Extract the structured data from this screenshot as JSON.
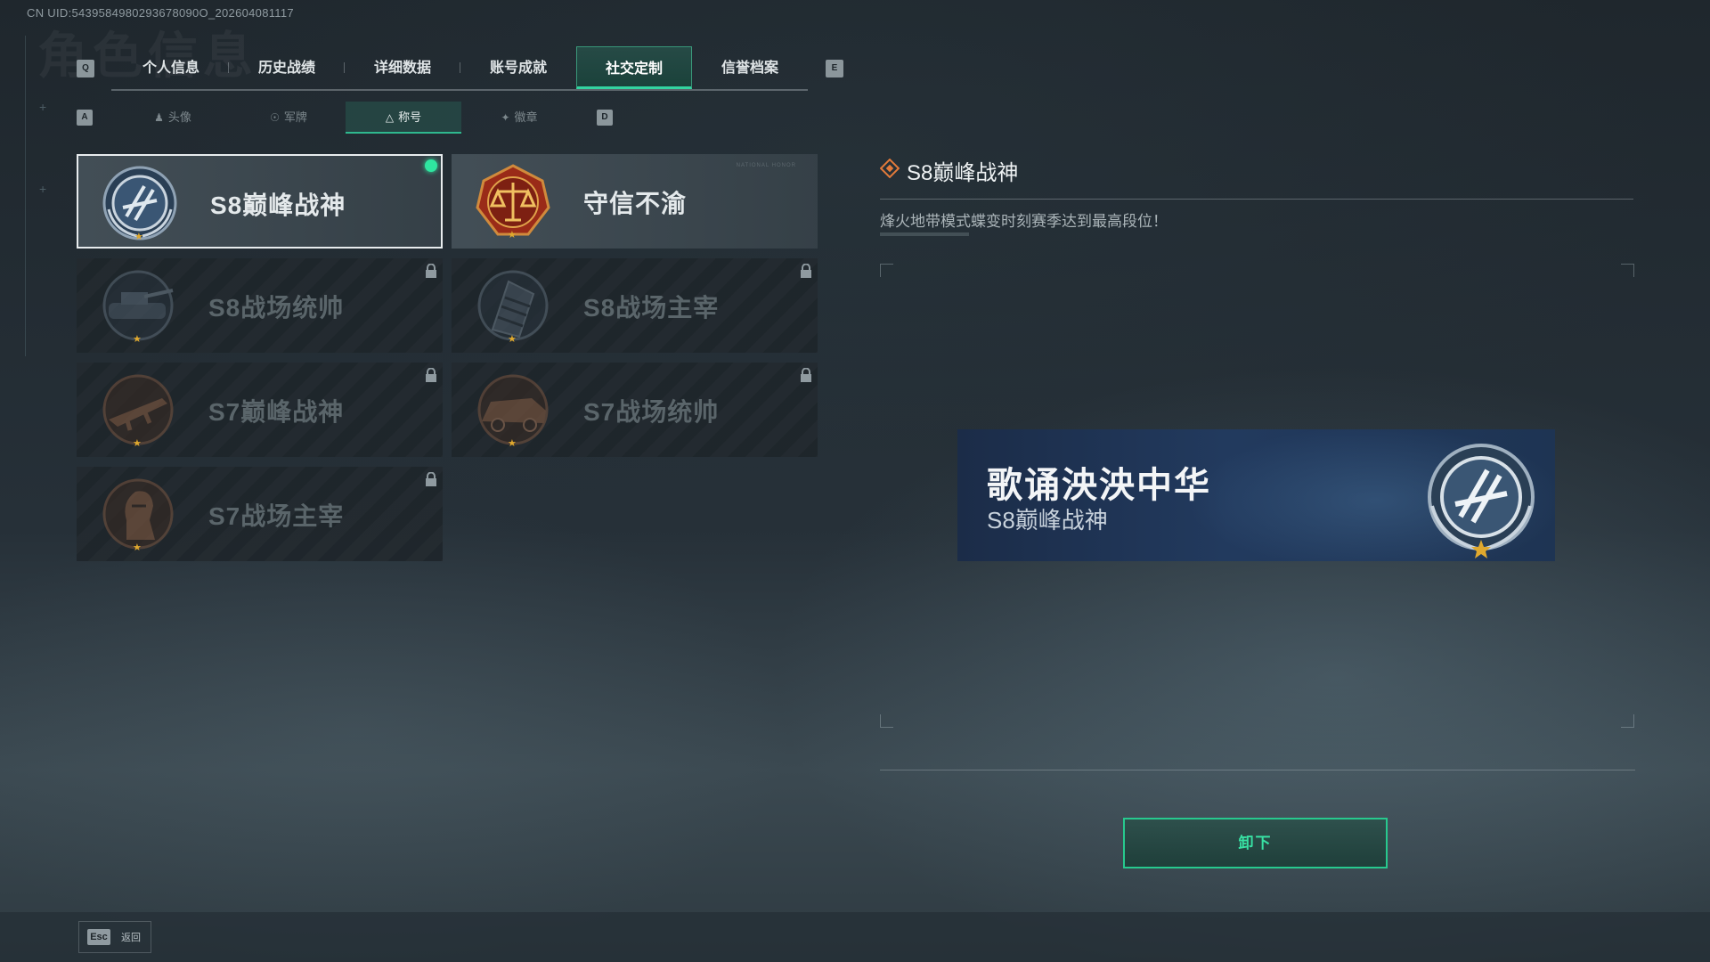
{
  "uid": "CN UID:5439584980293678090O_202604081117",
  "top_tabs": {
    "left_key": "Q",
    "right_key": "E",
    "items": [
      {
        "label": "个人信息"
      },
      {
        "label": "历史战绩"
      },
      {
        "label": "详细数据"
      },
      {
        "label": "账号成就"
      },
      {
        "label": "社交定制"
      },
      {
        "label": "信誉档案"
      }
    ],
    "active_index": 4
  },
  "sub_tabs": {
    "left_key": "A",
    "right_key": "D",
    "items": [
      {
        "label": "头像",
        "icon": "person-icon"
      },
      {
        "label": "军牌",
        "icon": "dogtag-icon"
      },
      {
        "label": "称号",
        "icon": "title-icon"
      },
      {
        "label": "徽章",
        "icon": "badge-icon"
      }
    ],
    "active_index": 2
  },
  "titles": [
    {
      "name": "S8巅峰战神",
      "state": "equipped",
      "emblem": "wreath-emblem-icon"
    },
    {
      "name": "守信不渝",
      "state": "owned",
      "emblem": "scales-emblem-icon"
    },
    {
      "name": "S8战场统帅",
      "state": "locked",
      "emblem": "tank-emblem-icon"
    },
    {
      "name": "S8战场主宰",
      "state": "locked",
      "emblem": "building-emblem-icon"
    },
    {
      "name": "S7巅峰战神",
      "state": "locked",
      "emblem": "rifle-emblem-icon"
    },
    {
      "name": "S7战场统帅",
      "state": "locked",
      "emblem": "vehicle-emblem-icon"
    },
    {
      "name": "S7战场主宰",
      "state": "locked",
      "emblem": "soldier-emblem-icon"
    }
  ],
  "detail": {
    "title": "S8巅峰战神",
    "description": "烽火地带模式蝶变时刻赛季达到最高段位！",
    "preview_player_name": "歌诵泱泱中华",
    "preview_title": "S8巅峰战神"
  },
  "action_button": "卸下",
  "footer": {
    "esc_key": "Esc",
    "back_label": "返回"
  },
  "colors": {
    "accent": "#33d4a0",
    "star": "#e0a92e",
    "preview_bg": "#223a5e"
  }
}
